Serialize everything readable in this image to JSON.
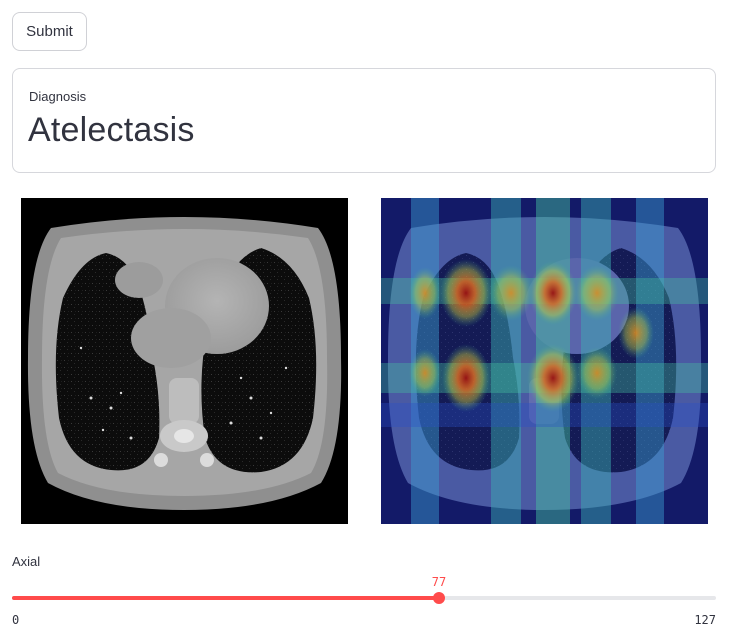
{
  "submit": {
    "label": "Submit"
  },
  "diagnosis": {
    "label": "Diagnosis",
    "value": "Atelectasis"
  },
  "images": [
    {
      "name": "ct-axial-slice"
    },
    {
      "name": "gradcam-heatmap-overlay"
    }
  ],
  "slider": {
    "label": "Axial",
    "value": "77",
    "min": "0",
    "max": "127",
    "accent_color": "#ff4b4b",
    "track_color": "#e6e7ea"
  }
}
